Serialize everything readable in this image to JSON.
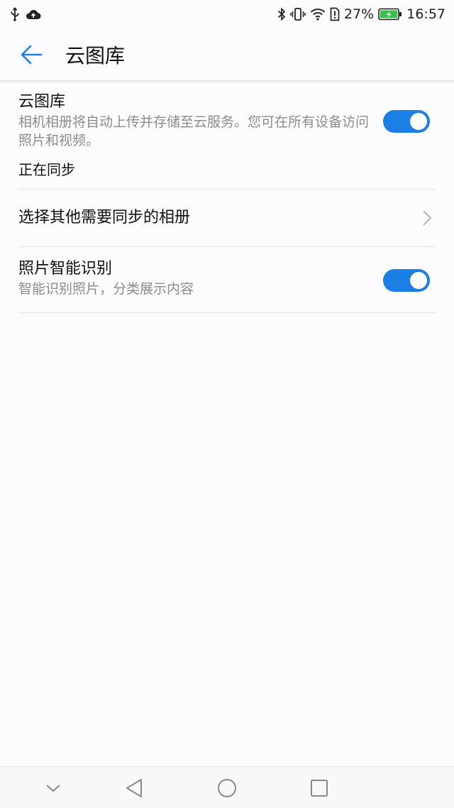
{
  "status_bar": {
    "battery_text": "27%",
    "time": "16:57"
  },
  "app_bar": {
    "title": "云图库"
  },
  "settings": {
    "cloud_gallery": {
      "title": "云图库",
      "description": "相机相册将自动上传并存储至云服务。您可在所有设备访问照片和视频。",
      "status": "正在同步",
      "enabled": true
    },
    "other_albums": {
      "title": "选择其他需要同步的相册"
    },
    "smart_recognition": {
      "title": "照片智能识别",
      "description": "智能识别照片，分类展示内容",
      "enabled": true
    }
  },
  "colors": {
    "accent": "#1b7fe6",
    "battery_green": "#36c24a"
  }
}
